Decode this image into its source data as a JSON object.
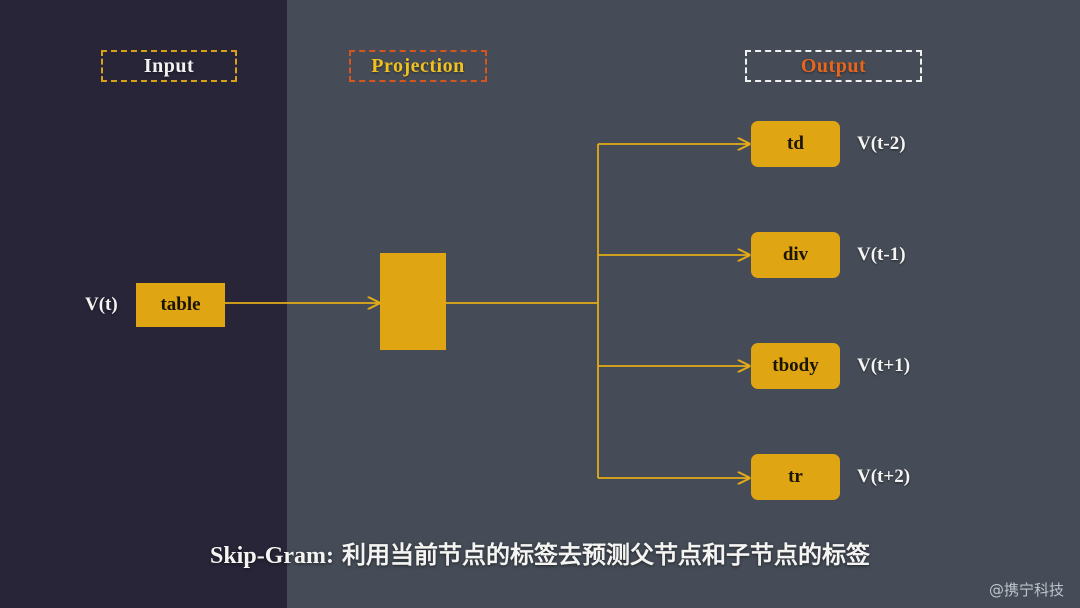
{
  "diagram": {
    "title_caption": {
      "term": "Skip-Gram:",
      "body": "利用当前节点的标签去预测父节点和子节点的标签"
    },
    "watermark": "@携宁科技",
    "colors": {
      "panel_left_bg": "#282538",
      "panel_right_bg": "#454c57",
      "node_gold": "#dfa513",
      "wire_gold": "#e3ab16",
      "input_chip_border": "#d8a11a",
      "projection_chip_border": "#d4551d",
      "projection_chip_text": "#f0c020",
      "output_chip_border": "#f0f0f0",
      "output_chip_text": "#e8651c",
      "label_text": "#f4f4f2",
      "node_text": "#1a1405"
    },
    "sections": [
      {
        "id": "input",
        "label": "Input"
      },
      {
        "id": "projection",
        "label": "Projection"
      },
      {
        "id": "output",
        "label": "Output"
      }
    ],
    "input_node": {
      "label": "table",
      "vector_label": "V(t)"
    },
    "projection_node": {
      "label": ""
    },
    "output_nodes": [
      {
        "label": "td",
        "vector_label": "V(t-2)"
      },
      {
        "label": "div",
        "vector_label": "V(t-1)"
      },
      {
        "label": "tbody",
        "vector_label": "V(t+1)"
      },
      {
        "label": "tr",
        "vector_label": "V(t+2)"
      }
    ]
  }
}
